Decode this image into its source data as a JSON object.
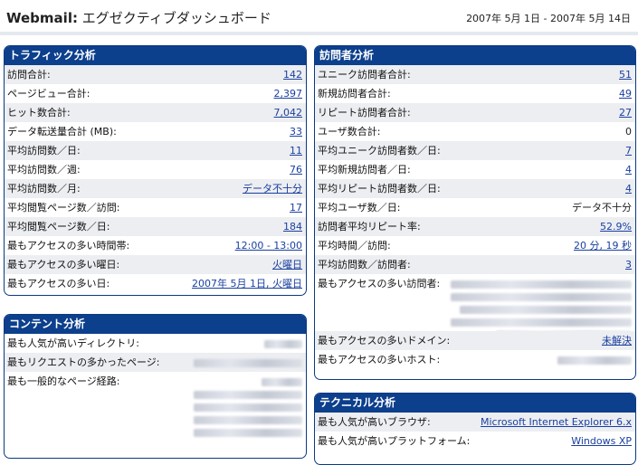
{
  "header": {
    "app": "Webmail:",
    "title": "エグゼクティブダッシュボード",
    "date_range": "2007年 5月 1日 - 2007年 5月 14日"
  },
  "traffic": {
    "title": "トラフィック分析",
    "rows": [
      {
        "label": "訪問合計:",
        "value": "142"
      },
      {
        "label": "ページビュー合計:",
        "value": "2,397"
      },
      {
        "label": "ヒット数合計:",
        "value": "7,042"
      },
      {
        "label": "データ転送量合計 (MB):",
        "value": "33"
      },
      {
        "label": "平均訪問数／日:",
        "value": "11"
      },
      {
        "label": "平均訪問数／週:",
        "value": "76"
      },
      {
        "label": "平均訪問数／月:",
        "value": "データ不十分"
      },
      {
        "label": "平均閲覧ページ数／訪問:",
        "value": "17"
      },
      {
        "label": "平均閲覧ページ数／日:",
        "value": "184"
      },
      {
        "label": "最もアクセスの多い時間帯:",
        "value": "12:00 - 13:00"
      },
      {
        "label": "最もアクセスの多い曜日:",
        "value": "火曜日"
      },
      {
        "label": "最もアクセスの多い日:",
        "value": "2007年 5月 1日, 火曜日"
      }
    ]
  },
  "visitors": {
    "title": "訪問者分析",
    "rows": [
      {
        "label": "ユニーク訪問者合計:",
        "value": "51"
      },
      {
        "label": "新規訪問者合計:",
        "value": "49"
      },
      {
        "label": "リピート訪問者合計:",
        "value": "27"
      },
      {
        "label": "ユーザ数合計:",
        "value": "0"
      },
      {
        "label": "平均ユニーク訪問者数／日:",
        "value": "7"
      },
      {
        "label": "平均新規訪問者／日:",
        "value": "4"
      },
      {
        "label": "平均リピート訪問者数／日:",
        "value": "4"
      },
      {
        "label": "平均ユーザ数／日:",
        "value": "データ不十分"
      },
      {
        "label": "訪問者平均リピート率:",
        "value": "52.9%"
      },
      {
        "label": "平均時間／訪問:",
        "value": "20 分, 19 秒"
      },
      {
        "label": "平均訪問数／訪問者:",
        "value": "3"
      },
      {
        "label": "最もアクセスの多い訪問者:",
        "value": ""
      },
      {
        "label": "最もアクセスの多いドメイン:",
        "value": "未解決"
      },
      {
        "label": "最もアクセスの多いホスト:",
        "value": ""
      }
    ]
  },
  "content": {
    "title": "コンテント分析",
    "rows": [
      {
        "label": "最も人気が高いディレクトリ:"
      },
      {
        "label": "最もリクエストの多かったページ:"
      },
      {
        "label": "最も一般的なページ経路:"
      }
    ]
  },
  "technical": {
    "title": "テクニカル分析",
    "rows": [
      {
        "label": "最も人気が高いブラウザ:",
        "value": "Microsoft Internet Explorer 6.x"
      },
      {
        "label": "最も人気が高いプラットフォーム:",
        "value": "Windows XP"
      }
    ]
  }
}
